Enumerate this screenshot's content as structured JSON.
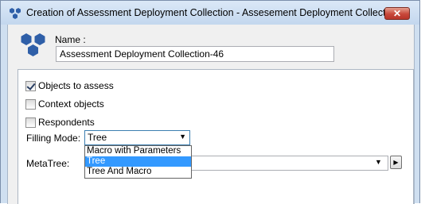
{
  "window": {
    "title": "Creation of Assessment Deployment Collection - Assesement Deployment Collecti...",
    "close_label": "✕"
  },
  "header": {
    "name_label": "Name :",
    "name_value": "Assessment Deployment Collection-46"
  },
  "options": {
    "objects_to_assess": {
      "label": "Objects to assess",
      "checked": true
    },
    "context_objects": {
      "label": "Context objects",
      "checked": false
    },
    "respondents": {
      "label": "Respondents",
      "checked": false
    }
  },
  "filling_mode": {
    "label": "Filling Mode:",
    "selected": "Tree",
    "options": [
      "Macro with Parameters",
      "Tree",
      "Tree And Macro"
    ]
  },
  "metatree": {
    "label": "MetaTree:",
    "value": ""
  },
  "icons": {
    "title_icon": "blue-hexagons-icon",
    "header_icon": "blue-hexagons-icon",
    "dropdown_arrow": "chevron-down-icon",
    "browse_arrow": "chevron-right-icon"
  },
  "colors": {
    "title_bar": "#c3d7ee",
    "close_button": "#c7473a",
    "selection": "#3399ff",
    "icon_blue": "#2f5fa8"
  }
}
